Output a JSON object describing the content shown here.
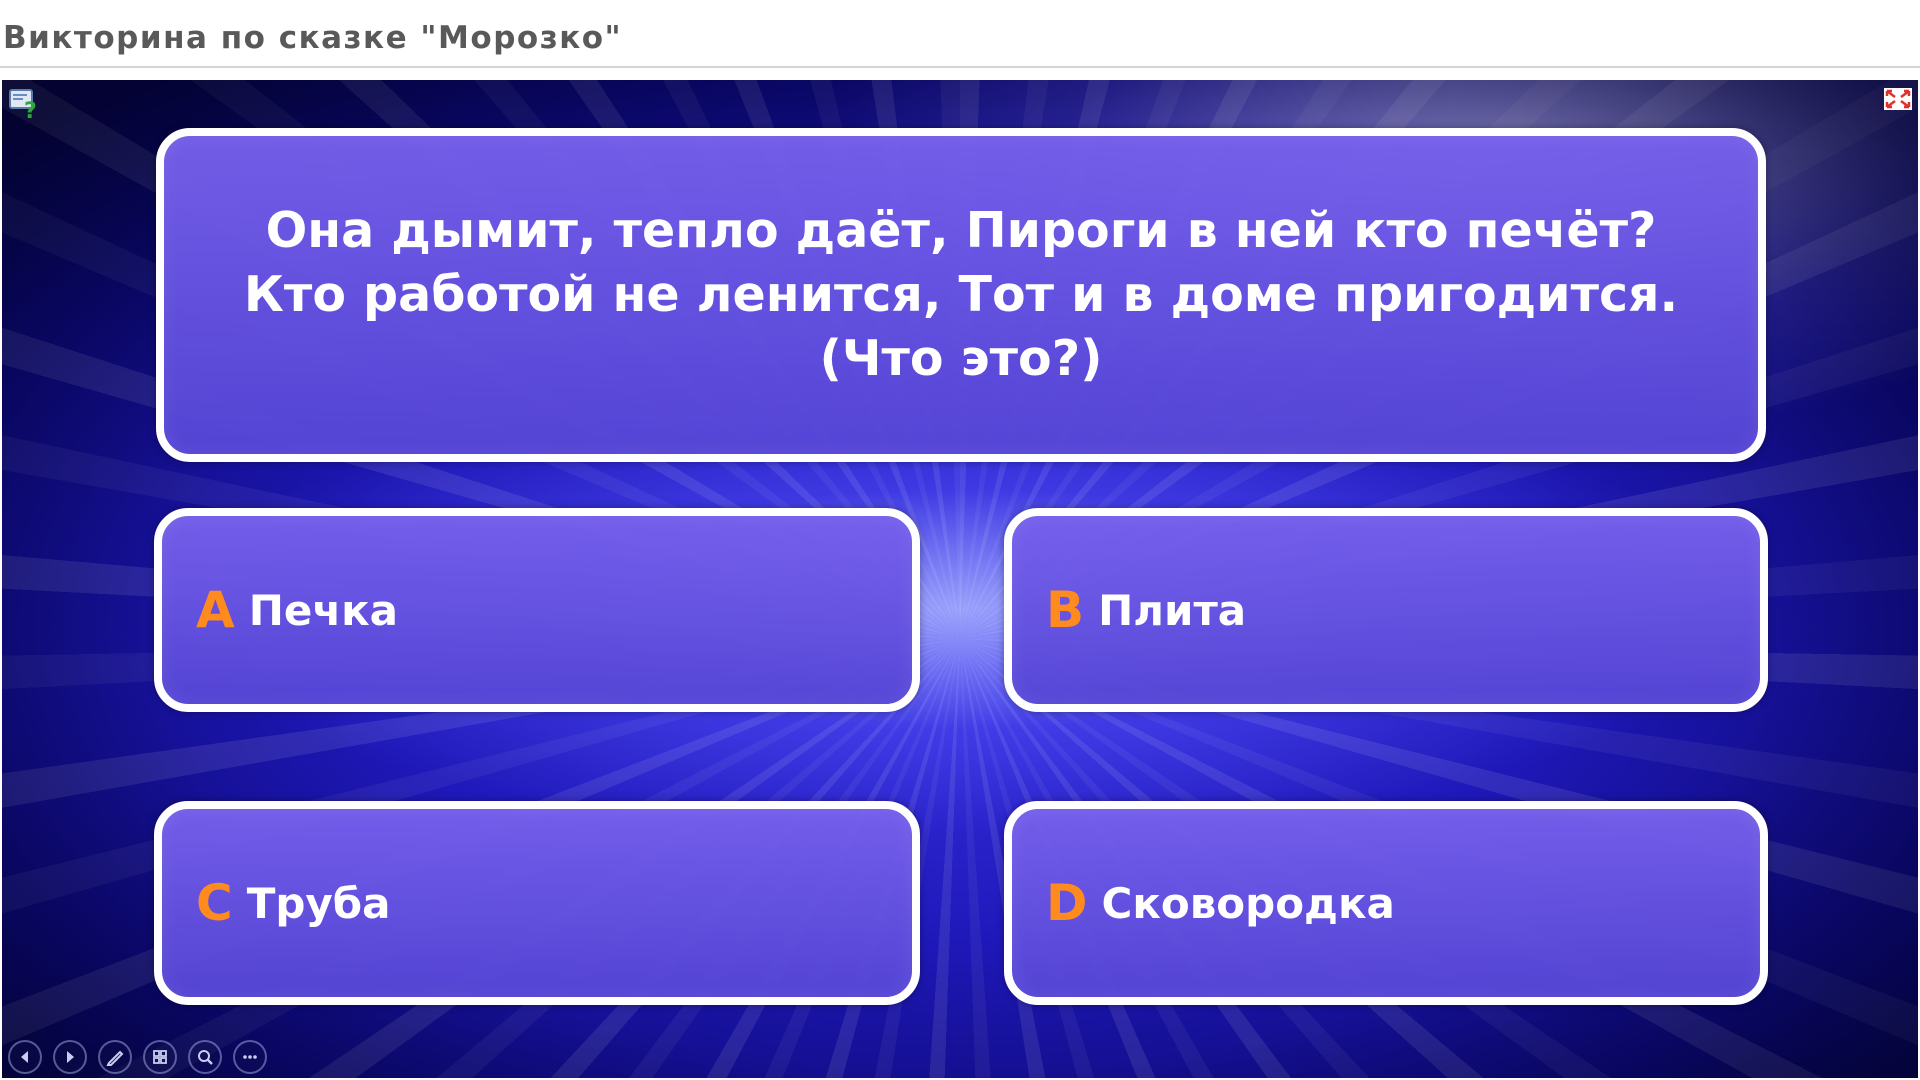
{
  "header": {
    "title": "Викторина по сказке \"Морозко\""
  },
  "question": {
    "text": "Она дымит, тепло даёт, Пироги в ней кто печёт? Кто работой не ленится, Тот и в доме пригодится. (Что это?)"
  },
  "answers": [
    {
      "letter": "A",
      "text": "Печка"
    },
    {
      "letter": "B",
      "text": "Плита"
    },
    {
      "letter": "C",
      "text": "Труба"
    },
    {
      "letter": "D",
      "text": "Сковородка"
    }
  ],
  "icons": {
    "help": "help-icon",
    "fullscreen": "fullscreen-icon",
    "toolbar": [
      "previous-slide-icon",
      "next-slide-icon",
      "pen-icon",
      "slides-grid-icon",
      "zoom-icon",
      "more-options-icon"
    ]
  },
  "colors": {
    "answer_letter": "#ff8a1e",
    "box_fill": "#6a58de",
    "box_border": "#ffffff",
    "title_text": "#595959"
  }
}
